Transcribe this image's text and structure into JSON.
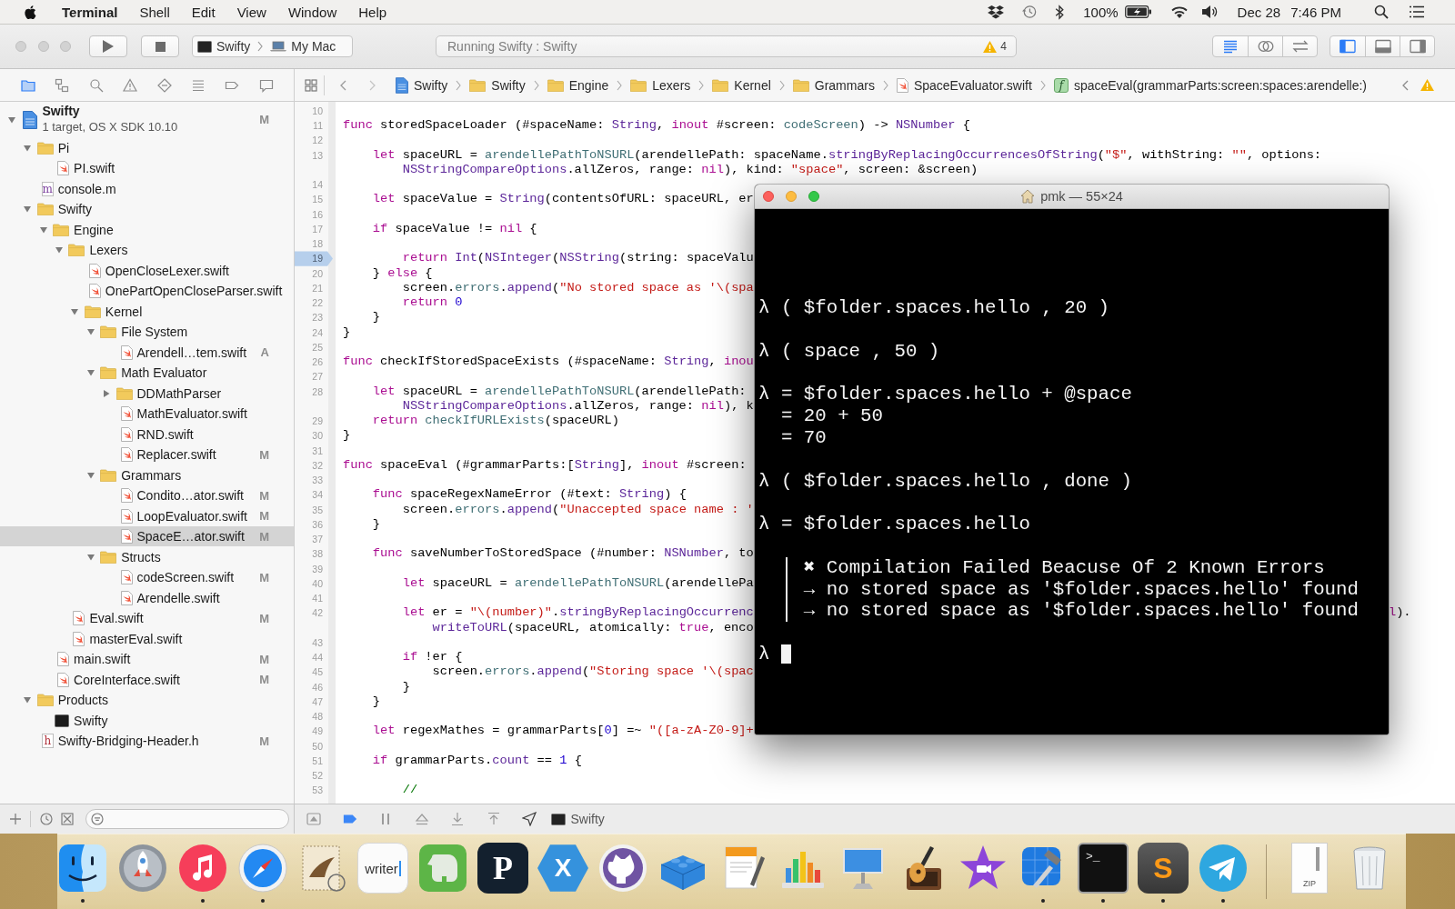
{
  "menu_bar": {
    "app": "Terminal",
    "menus": [
      "Shell",
      "Edit",
      "View",
      "Window",
      "Help"
    ],
    "battery": "100%",
    "date": "Dec 28",
    "time": "7:46 PM"
  },
  "toolbar": {
    "scheme": "Swifty",
    "destination": "My Mac",
    "activity": "Running Swifty : Swifty",
    "warnings": "4",
    "editor_modes": [
      {
        "kind": "standard",
        "selected": true
      },
      {
        "kind": "assistant",
        "selected": false
      },
      {
        "kind": "version",
        "selected": false
      }
    ],
    "panels": [
      {
        "kind": "navigator",
        "on": true
      },
      {
        "kind": "debug",
        "on": false
      },
      {
        "kind": "utilities",
        "on": false
      }
    ]
  },
  "navigator_tabs": [
    {
      "kind": "folder",
      "selected": true
    },
    {
      "kind": "symbols",
      "selected": false
    },
    {
      "kind": "search",
      "selected": false
    },
    {
      "kind": "issues",
      "selected": false
    },
    {
      "kind": "tests",
      "selected": false
    },
    {
      "kind": "debug",
      "selected": false
    },
    {
      "kind": "breakpoints",
      "selected": false
    },
    {
      "kind": "reports",
      "selected": false
    }
  ],
  "jump_bar": {
    "path": [
      {
        "kind": "project",
        "label": "Swifty"
      },
      {
        "kind": "folder",
        "label": "Swifty"
      },
      {
        "kind": "folder",
        "label": "Engine"
      },
      {
        "kind": "folder",
        "label": "Lexers"
      },
      {
        "kind": "folder",
        "label": "Kernel"
      },
      {
        "kind": "folder",
        "label": "Grammars"
      },
      {
        "kind": "swift",
        "label": "SpaceEvaluator.swift"
      },
      {
        "kind": "function",
        "icon_letter": "f",
        "label": "spaceEval(grammarParts:screen:spaces:arendelle:)"
      }
    ]
  },
  "project_tree": {
    "root": {
      "name": "Swifty",
      "subtitle": "1 target, OS X SDK 10.10",
      "status": "M",
      "expanded": true,
      "selected": false
    },
    "items": [
      {
        "kind": "folder",
        "name": "Pi",
        "expanded": true,
        "selected": false,
        "children": [
          {
            "kind": "swift",
            "name": "PI.swift",
            "selected": false
          }
        ]
      },
      {
        "kind": "objc",
        "icon_letter": "m",
        "name": "console.m",
        "selected": false
      },
      {
        "kind": "folder",
        "name": "Swifty",
        "expanded": true,
        "selected": false,
        "children": [
          {
            "kind": "folder",
            "name": "Engine",
            "expanded": true,
            "selected": false,
            "children": [
              {
                "kind": "folder",
                "name": "Lexers",
                "expanded": true,
                "selected": false,
                "children": [
                  {
                    "kind": "swift",
                    "name": "OpenCloseLexer.swift",
                    "selected": false
                  },
                  {
                    "kind": "swift",
                    "name": "OnePartOpenCloseParser.swift",
                    "selected": false
                  },
                  {
                    "kind": "folder",
                    "name": "Kernel",
                    "expanded": true,
                    "selected": false,
                    "children": [
                      {
                        "kind": "folder",
                        "name": "File System",
                        "expanded": true,
                        "selected": false,
                        "children": [
                          {
                            "kind": "swift",
                            "name": "Arendell…tem.swift",
                            "status": "A",
                            "selected": false
                          }
                        ]
                      },
                      {
                        "kind": "folder",
                        "name": "Math Evaluator",
                        "expanded": true,
                        "selected": false,
                        "children": [
                          {
                            "kind": "folder",
                            "name": "DDMathParser",
                            "expanded": false,
                            "selected": false
                          },
                          {
                            "kind": "swift",
                            "name": "MathEvaluator.swift",
                            "selected": false
                          },
                          {
                            "kind": "swift",
                            "name": "RND.swift",
                            "selected": false
                          },
                          {
                            "kind": "swift",
                            "name": "Replacer.swift",
                            "status": "M",
                            "selected": false
                          }
                        ]
                      },
                      {
                        "kind": "folder",
                        "name": "Grammars",
                        "expanded": true,
                        "selected": false,
                        "children": [
                          {
                            "kind": "swift",
                            "name": "Condito…ator.swift",
                            "status": "M",
                            "selected": false
                          },
                          {
                            "kind": "swift",
                            "name": "LoopEvaluator.swift",
                            "status": "M",
                            "selected": false
                          },
                          {
                            "kind": "swift",
                            "name": "SpaceE…ator.swift",
                            "status": "M",
                            "selected": true
                          }
                        ]
                      },
                      {
                        "kind": "folder",
                        "name": "Structs",
                        "expanded": true,
                        "selected": false,
                        "children": [
                          {
                            "kind": "swift",
                            "name": "codeScreen.swift",
                            "status": "M",
                            "selected": false
                          },
                          {
                            "kind": "swift",
                            "name": "Arendelle.swift",
                            "selected": false
                          }
                        ]
                      }
                    ]
                  }
                ]
              },
              {
                "kind": "swift",
                "name": "Eval.swift",
                "status": "M",
                "selected": false
              },
              {
                "kind": "swift",
                "name": "masterEval.swift",
                "selected": false
              }
            ]
          },
          {
            "kind": "swift",
            "name": "main.swift",
            "status": "M",
            "selected": false
          },
          {
            "kind": "swift",
            "name": "CoreInterface.swift",
            "status": "M",
            "selected": false
          }
        ]
      },
      {
        "kind": "folder",
        "name": "Products",
        "expanded": true,
        "selected": false,
        "children": [
          {
            "kind": "app",
            "name": "Swifty",
            "selected": false
          }
        ]
      },
      {
        "kind": "header",
        "icon_letter": "h",
        "name": "Swifty-Bridging-Header.h",
        "status": "M",
        "selected": false
      }
    ]
  },
  "editor": {
    "lines": [
      {
        "number": "10",
        "breakpoint": false
      },
      {
        "number": "11",
        "breakpoint": false,
        "tokens": [
          {
            "kind": "keyword",
            "text": "func"
          },
          {
            "kind": "plain",
            "text": " storedSpaceLoader (#spaceName: "
          },
          {
            "kind": "type",
            "text": "String"
          },
          {
            "kind": "plain",
            "text": ", "
          },
          {
            "kind": "keyword",
            "text": "inout"
          },
          {
            "kind": "plain",
            "text": " #screen: "
          },
          {
            "kind": "project",
            "text": "codeScreen"
          },
          {
            "kind": "plain",
            "text": ") -> "
          },
          {
            "kind": "type",
            "text": "NSNumber"
          },
          {
            "kind": "plain",
            "text": " {"
          }
        ]
      },
      {
        "number": "12",
        "breakpoint": false
      },
      {
        "number": "13",
        "breakpoint": false,
        "tokens": [
          {
            "kind": "keyword",
            "text": "    let"
          },
          {
            "kind": "plain",
            "text": " spaceURL = "
          },
          {
            "kind": "project",
            "text": "arendellePathToNSURL"
          },
          {
            "kind": "plain",
            "text": "(arendellePath: spaceName."
          },
          {
            "kind": "type",
            "text": "stringByReplacingOccurrencesOfString"
          },
          {
            "kind": "plain",
            "text": "("
          },
          {
            "kind": "string",
            "text": "\"$\""
          },
          {
            "kind": "plain",
            "text": ", withString: "
          },
          {
            "kind": "string",
            "text": "\"\""
          },
          {
            "kind": "plain",
            "text": ", options:"
          }
        ],
        "continuation": [
          {
            "kind": "type",
            "text": "        NSStringCompareOptions"
          },
          {
            "kind": "plain",
            "text": ".allZeros, range: "
          },
          {
            "kind": "keyword",
            "text": "nil"
          },
          {
            "kind": "plain",
            "text": "), kind: "
          },
          {
            "kind": "string",
            "text": "\"space\""
          },
          {
            "kind": "plain",
            "text": ", screen: &screen)"
          }
        ]
      },
      {
        "number": "14",
        "breakpoint": false
      },
      {
        "number": "15",
        "breakpoint": false,
        "tokens": [
          {
            "kind": "keyword",
            "text": "    let"
          },
          {
            "kind": "plain",
            "text": " spaceValue = "
          },
          {
            "kind": "type",
            "text": "String"
          },
          {
            "kind": "plain",
            "text": "(contentsOfURL: spaceURL, er"
          }
        ]
      },
      {
        "number": "16",
        "breakpoint": false
      },
      {
        "number": "17",
        "breakpoint": false,
        "tokens": [
          {
            "kind": "keyword",
            "text": "    if"
          },
          {
            "kind": "plain",
            "text": " spaceValue != "
          },
          {
            "kind": "keyword",
            "text": "nil"
          },
          {
            "kind": "plain",
            "text": " {"
          }
        ]
      },
      {
        "number": "18",
        "breakpoint": false
      },
      {
        "number": "19",
        "breakpoint": true,
        "tokens": [
          {
            "kind": "keyword",
            "text": "        return "
          },
          {
            "kind": "type",
            "text": "Int"
          },
          {
            "kind": "plain",
            "text": "("
          },
          {
            "kind": "type",
            "text": "NSInteger"
          },
          {
            "kind": "plain",
            "text": "("
          },
          {
            "kind": "type",
            "text": "NSString"
          },
          {
            "kind": "plain",
            "text": "(string: spaceValu"
          }
        ]
      },
      {
        "number": "20",
        "breakpoint": false,
        "tokens": [
          {
            "kind": "plain",
            "text": "    } "
          },
          {
            "kind": "keyword",
            "text": "else"
          },
          {
            "kind": "plain",
            "text": " {"
          }
        ]
      },
      {
        "number": "21",
        "breakpoint": false,
        "tokens": [
          {
            "kind": "plain",
            "text": "        screen."
          },
          {
            "kind": "project",
            "text": "errors"
          },
          {
            "kind": "plain",
            "text": "."
          },
          {
            "kind": "type",
            "text": "append"
          },
          {
            "kind": "plain",
            "text": "("
          },
          {
            "kind": "string",
            "text": "\"No stored space as '\\(spa"
          }
        ]
      },
      {
        "number": "22",
        "breakpoint": false,
        "tokens": [
          {
            "kind": "keyword",
            "text": "        return "
          },
          {
            "kind": "number",
            "text": "0"
          }
        ]
      },
      {
        "number": "23",
        "breakpoint": false,
        "tokens": [
          {
            "kind": "plain",
            "text": "    }"
          }
        ]
      },
      {
        "number": "24",
        "breakpoint": false,
        "tokens": [
          {
            "kind": "plain",
            "text": "}"
          }
        ]
      },
      {
        "number": "25",
        "breakpoint": false
      },
      {
        "number": "26",
        "breakpoint": false,
        "tokens": [
          {
            "kind": "keyword",
            "text": "func"
          },
          {
            "kind": "plain",
            "text": " checkIfStoredSpaceExists (#spaceName: "
          },
          {
            "kind": "type",
            "text": "String"
          },
          {
            "kind": "plain",
            "text": ", "
          },
          {
            "kind": "keyword",
            "text": "inou"
          }
        ]
      },
      {
        "number": "27",
        "breakpoint": false
      },
      {
        "number": "28",
        "breakpoint": false,
        "tokens": [
          {
            "kind": "keyword",
            "text": "    let"
          },
          {
            "kind": "plain",
            "text": " spaceURL = "
          },
          {
            "kind": "project",
            "text": "arendellePathToNSURL"
          },
          {
            "kind": "plain",
            "text": "(arendellePath:"
          }
        ],
        "continuation": [
          {
            "kind": "type",
            "text": "        NSStringCompareOptions"
          },
          {
            "kind": "plain",
            "text": ".allZeros, range: "
          },
          {
            "kind": "keyword",
            "text": "nil"
          },
          {
            "kind": "plain",
            "text": "), k"
          }
        ]
      },
      {
        "number": "29",
        "breakpoint": false,
        "tokens": [
          {
            "kind": "keyword",
            "text": "    return "
          },
          {
            "kind": "project",
            "text": "checkIfURLExists"
          },
          {
            "kind": "plain",
            "text": "(spaceURL)"
          }
        ]
      },
      {
        "number": "30",
        "breakpoint": false,
        "tokens": [
          {
            "kind": "plain",
            "text": "}"
          }
        ]
      },
      {
        "number": "31",
        "breakpoint": false
      },
      {
        "number": "32",
        "breakpoint": false,
        "tokens": [
          {
            "kind": "keyword",
            "text": "func"
          },
          {
            "kind": "plain",
            "text": " spaceEval (#grammarParts:["
          },
          {
            "kind": "type",
            "text": "String"
          },
          {
            "kind": "plain",
            "text": "], "
          },
          {
            "kind": "keyword",
            "text": "inout"
          },
          {
            "kind": "plain",
            "text": " #screen:"
          }
        ]
      },
      {
        "number": "33",
        "breakpoint": false
      },
      {
        "number": "34",
        "breakpoint": false,
        "tokens": [
          {
            "kind": "keyword",
            "text": "    func"
          },
          {
            "kind": "plain",
            "text": " spaceRegexNameError (#text: "
          },
          {
            "kind": "type",
            "text": "String"
          },
          {
            "kind": "plain",
            "text": ") {"
          }
        ]
      },
      {
        "number": "35",
        "breakpoint": false,
        "tokens": [
          {
            "kind": "plain",
            "text": "        screen."
          },
          {
            "kind": "project",
            "text": "errors"
          },
          {
            "kind": "plain",
            "text": "."
          },
          {
            "kind": "type",
            "text": "append"
          },
          {
            "kind": "plain",
            "text": "("
          },
          {
            "kind": "string",
            "text": "\"Unaccepted space name : '"
          }
        ]
      },
      {
        "number": "36",
        "breakpoint": false,
        "tokens": [
          {
            "kind": "plain",
            "text": "    }"
          }
        ]
      },
      {
        "number": "37",
        "breakpoint": false
      },
      {
        "number": "38",
        "breakpoint": false,
        "tokens": [
          {
            "kind": "keyword",
            "text": "    func"
          },
          {
            "kind": "plain",
            "text": " saveNumberToStoredSpace (#number: "
          },
          {
            "kind": "type",
            "text": "NSNumber"
          },
          {
            "kind": "plain",
            "text": ", to"
          }
        ]
      },
      {
        "number": "39",
        "breakpoint": false
      },
      {
        "number": "40",
        "breakpoint": false,
        "tokens": [
          {
            "kind": "keyword",
            "text": "        let"
          },
          {
            "kind": "plain",
            "text": " spaceURL = "
          },
          {
            "kind": "project",
            "text": "arendellePathToNSURL"
          },
          {
            "kind": "plain",
            "text": "(arendellePa"
          }
        ]
      },
      {
        "number": "41",
        "breakpoint": false
      },
      {
        "number": "42",
        "breakpoint": false,
        "tokens": [
          {
            "kind": "keyword",
            "text": "        let"
          },
          {
            "kind": "plain",
            "text": " er = "
          },
          {
            "kind": "string",
            "text": "\"\\(number)\""
          },
          {
            "kind": "plain",
            "text": "."
          },
          {
            "kind": "type",
            "text": "stringByReplacingOccurrenc"
          }
        ],
        "continuation": [
          {
            "kind": "type",
            "text": "            writeToURL"
          },
          {
            "kind": "plain",
            "text": "(spaceURL, atomically: "
          },
          {
            "kind": "keyword",
            "text": "true"
          },
          {
            "kind": "plain",
            "text": ", enco"
          }
        ],
        "tail": [
          {
            "kind": "keyword",
            "text": "l"
          },
          {
            "kind": "plain",
            "text": ")."
          }
        ]
      },
      {
        "number": "43",
        "breakpoint": false
      },
      {
        "number": "44",
        "breakpoint": false,
        "tokens": [
          {
            "kind": "keyword",
            "text": "        if"
          },
          {
            "kind": "plain",
            "text": " !er {"
          }
        ]
      },
      {
        "number": "45",
        "breakpoint": false,
        "tokens": [
          {
            "kind": "plain",
            "text": "            screen."
          },
          {
            "kind": "project",
            "text": "errors"
          },
          {
            "kind": "plain",
            "text": "."
          },
          {
            "kind": "type",
            "text": "append"
          },
          {
            "kind": "plain",
            "text": "("
          },
          {
            "kind": "string",
            "text": "\"Storing space '\\(spac"
          }
        ]
      },
      {
        "number": "46",
        "breakpoint": false,
        "tokens": [
          {
            "kind": "plain",
            "text": "        }"
          }
        ]
      },
      {
        "number": "47",
        "breakpoint": false,
        "tokens": [
          {
            "kind": "plain",
            "text": "    }"
          }
        ]
      },
      {
        "number": "48",
        "breakpoint": false
      },
      {
        "number": "49",
        "breakpoint": false,
        "tokens": [
          {
            "kind": "keyword",
            "text": "    let"
          },
          {
            "kind": "plain",
            "text": " regexMathes = grammarParts["
          },
          {
            "kind": "number",
            "text": "0"
          },
          {
            "kind": "plain",
            "text": "] =~ "
          },
          {
            "kind": "string",
            "text": "\"([a-zA-Z0-9]+"
          }
        ]
      },
      {
        "number": "50",
        "breakpoint": false
      },
      {
        "number": "51",
        "breakpoint": false,
        "tokens": [
          {
            "kind": "keyword",
            "text": "    if"
          },
          {
            "kind": "plain",
            "text": " grammarParts."
          },
          {
            "kind": "type",
            "text": "count"
          },
          {
            "kind": "plain",
            "text": " == "
          },
          {
            "kind": "number",
            "text": "1"
          },
          {
            "kind": "plain",
            "text": " {"
          }
        ]
      },
      {
        "number": "52",
        "breakpoint": false
      },
      {
        "number": "53",
        "breakpoint": false,
        "tokens": [
          {
            "kind": "comment",
            "text": "        //"
          }
        ]
      }
    ]
  },
  "debug_bar": {
    "process": "Swifty"
  },
  "terminal": {
    "title": "pmk — 55×24",
    "blocks": [
      {
        "kind": "output",
        "lines": [
          "λ ( $folder.spaces.hello , 20 )"
        ]
      },
      {
        "kind": "output",
        "lines": [
          "λ ( space , 50 )"
        ]
      },
      {
        "kind": "output",
        "lines": [
          "λ = $folder.spaces.hello + @space",
          "  = 20 + 50",
          "  = 70"
        ]
      },
      {
        "kind": "output",
        "lines": [
          "λ ( $folder.spaces.hello , done )"
        ]
      },
      {
        "kind": "output",
        "lines": [
          "λ = $folder.spaces.hello"
        ]
      },
      {
        "kind": "error",
        "lines": [
          "✖ Compilation Failed Beacuse Of 2 Known Errors",
          "→ no stored space as '$folder.spaces.hello' found",
          "→ no stored space as '$folder.spaces.hello' found"
        ]
      },
      {
        "kind": "prompt",
        "lines": [
          "λ"
        ]
      }
    ]
  },
  "dock": {
    "apps": [
      {
        "kind": "finder",
        "running": true
      },
      {
        "kind": "rocket",
        "running": false
      },
      {
        "kind": "music",
        "running": true
      },
      {
        "kind": "compass",
        "running": true
      },
      {
        "kind": "stamp",
        "running": false
      },
      {
        "kind": "wordmark",
        "label": "writer",
        "running": false
      },
      {
        "kind": "elephant",
        "running": false
      },
      {
        "kind": "letter",
        "label": "P",
        "running": false
      },
      {
        "kind": "hexagon",
        "label": "X",
        "running": false
      },
      {
        "kind": "cat",
        "running": false
      },
      {
        "kind": "brick",
        "running": false
      },
      {
        "kind": "document",
        "running": false
      },
      {
        "kind": "chart",
        "running": false
      },
      {
        "kind": "podium",
        "running": false
      },
      {
        "kind": "guitar",
        "running": false
      },
      {
        "kind": "star",
        "running": false
      },
      {
        "kind": "blueprint",
        "running": true
      },
      {
        "kind": "console",
        "label": ">_",
        "running": true
      },
      {
        "kind": "sublime",
        "label": "S",
        "running": true
      },
      {
        "kind": "plane",
        "running": true
      }
    ],
    "documents": [
      {
        "kind": "zip",
        "label": "ZIP"
      },
      {
        "kind": "trash"
      }
    ]
  }
}
